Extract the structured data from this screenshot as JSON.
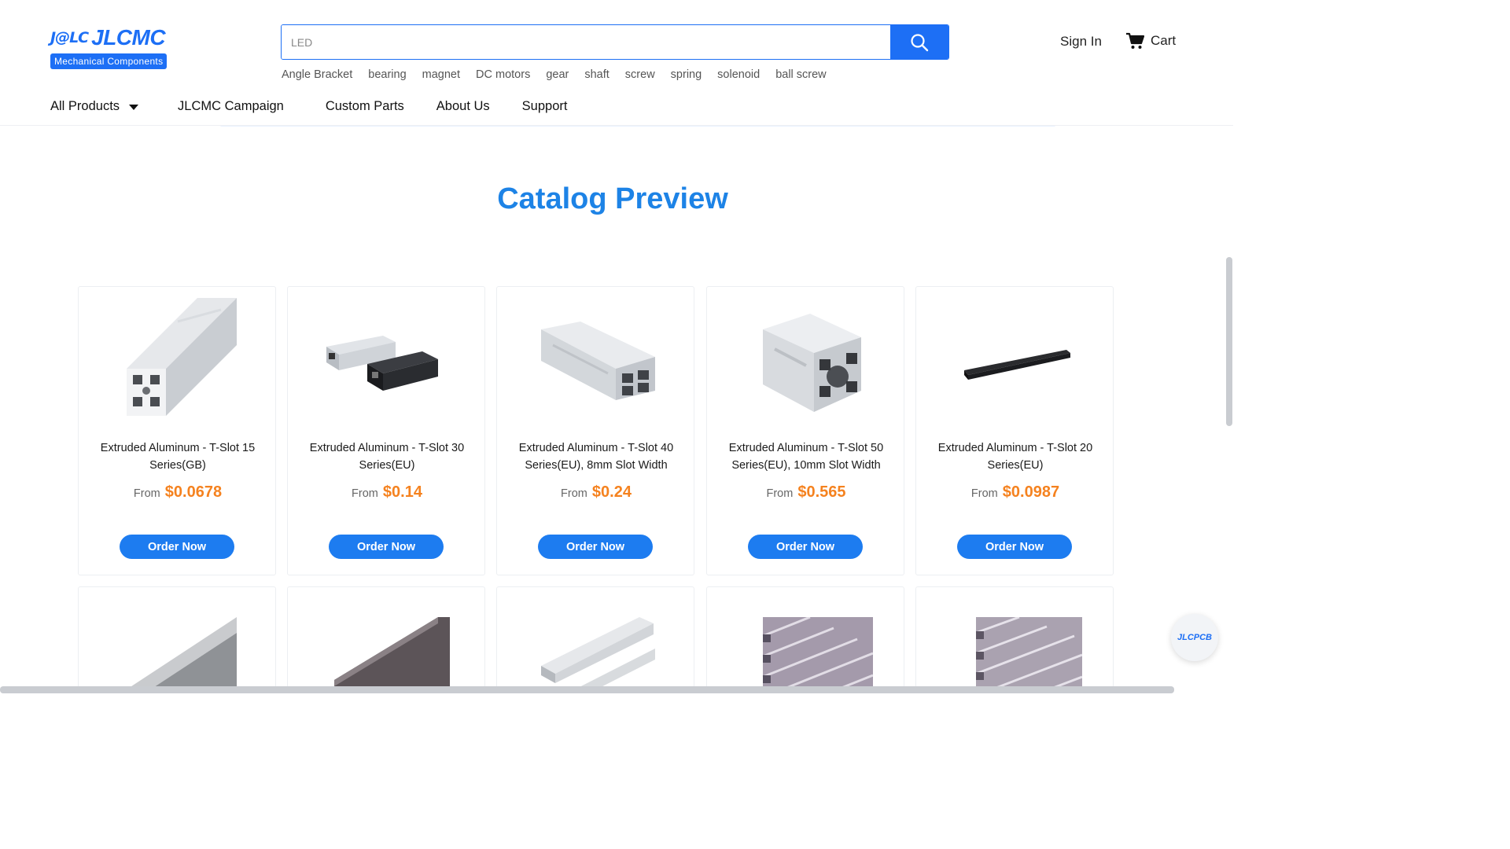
{
  "brand": {
    "mark": "J@LC",
    "name": "JLCMC",
    "tagline": "Mechanical Components"
  },
  "search": {
    "placeholder": "LED",
    "hot_terms": [
      "Angle Bracket",
      "bearing",
      "magnet",
      "DC motors",
      "gear",
      "shaft",
      "screw",
      "spring",
      "solenoid",
      "ball screw"
    ]
  },
  "account": {
    "sign_in": "Sign In",
    "cart": "Cart"
  },
  "nav": {
    "items": [
      "All Products",
      "JLCMC Campaign",
      "Custom Parts",
      "About Us",
      "Support"
    ]
  },
  "section": {
    "title": "Catalog Preview"
  },
  "products": [
    {
      "name": "Extruded Aluminum - T-Slot 15 Series(GB)",
      "from": "From",
      "price": "$0.0678",
      "cta": "Order Now"
    },
    {
      "name": "Extruded Aluminum - T-Slot 30 Series(EU)",
      "from": "From",
      "price": "$0.14",
      "cta": "Order Now"
    },
    {
      "name": "Extruded Aluminum - T-Slot 40 Series(EU), 8mm Slot Width",
      "from": "From",
      "price": "$0.24",
      "cta": "Order Now"
    },
    {
      "name": "Extruded Aluminum - T-Slot 50 Series(EU), 10mm Slot Width",
      "from": "From",
      "price": "$0.565",
      "cta": "Order Now"
    },
    {
      "name": "Extruded Aluminum - T-Slot 20 Series(EU)",
      "from": "From",
      "price": "$0.0987",
      "cta": "Order Now"
    }
  ],
  "float_badge": "JLCPCB",
  "colors": {
    "brand_blue": "#1d6ff5",
    "title_blue": "#1d83e6",
    "price_orange": "#f5821f",
    "button_blue": "#1d7cf0"
  },
  "icons": [
    "search-icon",
    "cart-icon",
    "caret-down-icon"
  ]
}
